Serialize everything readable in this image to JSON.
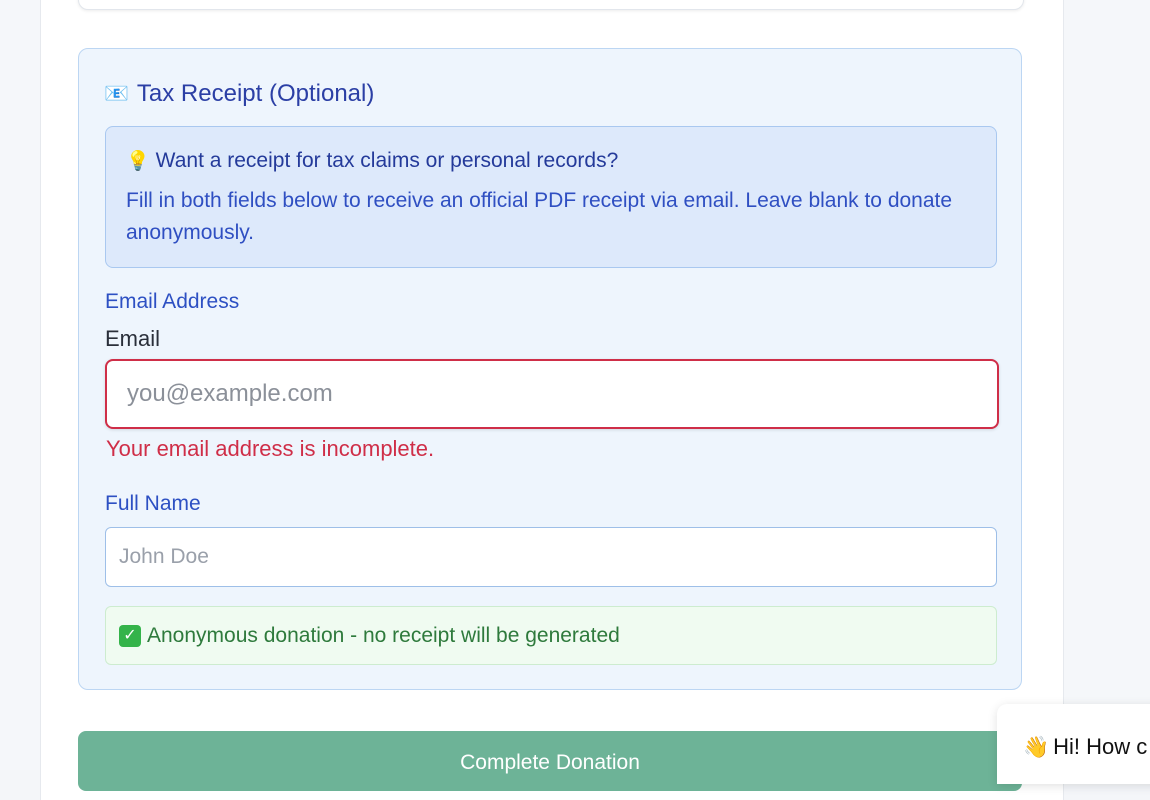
{
  "tax_receipt": {
    "title": "Tax Receipt (Optional)",
    "title_icon": "envelope-icon",
    "info": {
      "icon": "lightbulb-icon",
      "heading": "Want a receipt for tax claims or personal records?",
      "text": "Fill in both fields below to receive an official PDF receipt via email. Leave blank to donate anonymously."
    },
    "email": {
      "section_label": "Email Address",
      "field_label": "Email",
      "placeholder": "you@example.com",
      "value": "",
      "error": "Your email address is incomplete."
    },
    "full_name": {
      "label": "Full Name",
      "placeholder": "John Doe",
      "value": ""
    },
    "status": {
      "icon": "check-mark-icon",
      "text": "Anonymous donation - no receipt will be generated"
    }
  },
  "actions": {
    "complete_label": "Complete Donation"
  },
  "chat": {
    "icon": "waving-hand-icon",
    "text": "Hi! How c"
  },
  "colors": {
    "section_background": "#eef5fd",
    "title_text": "#2b3fa5",
    "error": "#cf2e48",
    "success_text": "#2e7a3c",
    "button": "#6db397"
  }
}
